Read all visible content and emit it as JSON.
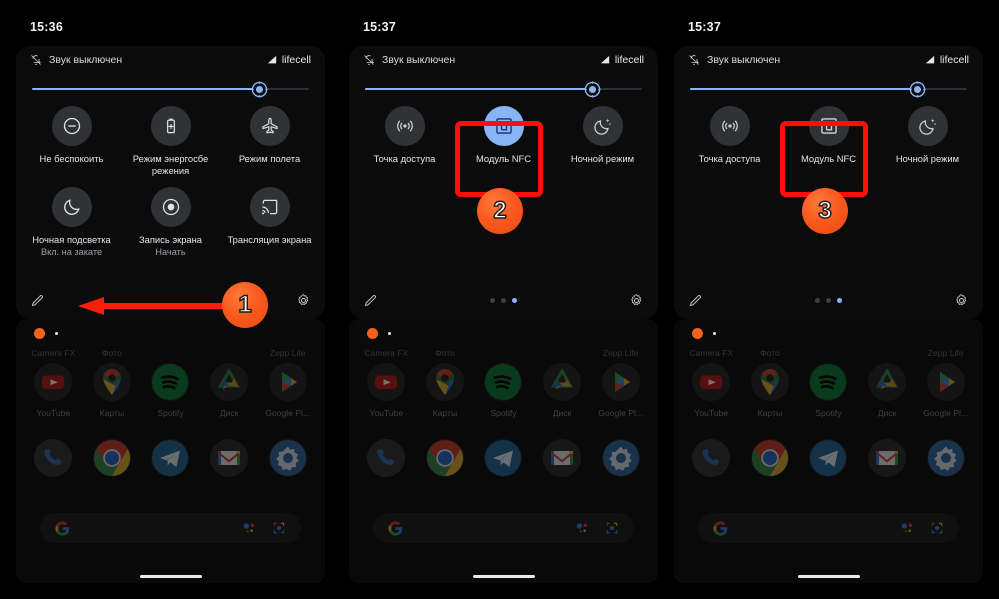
{
  "panels": [
    {
      "id": "panel-1",
      "clock": "15:36",
      "mute_label": "Звук выключен",
      "carrier": "lifecell",
      "brightness_percent": 82,
      "tiles_row1": [
        {
          "label": "Не беспокоить",
          "sub": "",
          "icon": "do-not-disturb-icon",
          "on": false
        },
        {
          "label": "Режим энергосбе режения",
          "sub": "",
          "icon": "battery-saver-icon",
          "on": false
        },
        {
          "label": "Режим полета",
          "sub": "",
          "icon": "airplane-mode-icon",
          "on": false
        }
      ],
      "tiles_row2": [
        {
          "label": "Ночная подсветка",
          "sub": "Вкл. на закате",
          "icon": "night-light-icon",
          "on": false
        },
        {
          "label": "Запись экрана",
          "sub": "Начать",
          "icon": "screen-record-icon",
          "on": false
        },
        {
          "label": "Трансляция экрана",
          "sub": "",
          "icon": "cast-icon",
          "on": false
        }
      ],
      "page_dots": 0,
      "show_dots": false
    },
    {
      "id": "panel-2",
      "clock": "15:37",
      "mute_label": "Звук выключен",
      "carrier": "lifecell",
      "brightness_percent": 82,
      "tiles_row1": [
        {
          "label": "Точка доступа",
          "sub": "",
          "icon": "hotspot-icon",
          "on": false
        },
        {
          "label": "Модуль NFC",
          "sub": "",
          "icon": "nfc-icon",
          "on": true
        },
        {
          "label": "Ночной режим",
          "sub": "",
          "icon": "night-mode-icon",
          "on": false
        }
      ],
      "tiles_row2": [],
      "page_dots": 3,
      "active_dot": 2,
      "show_dots": true
    },
    {
      "id": "panel-3",
      "clock": "15:37",
      "mute_label": "Звук выключен",
      "carrier": "lifecell",
      "brightness_percent": 82,
      "tiles_row1": [
        {
          "label": "Точка доступа",
          "sub": "",
          "icon": "hotspot-icon",
          "on": false
        },
        {
          "label": "Модуль NFC",
          "sub": "",
          "icon": "nfc-icon",
          "on": false
        },
        {
          "label": "Ночной режим",
          "sub": "",
          "icon": "night-mode-icon",
          "on": false
        }
      ],
      "tiles_row2": [],
      "page_dots": 3,
      "active_dot": 2,
      "show_dots": true
    }
  ],
  "home": {
    "cut_row_labels": [
      "Camera FX",
      "Фото",
      "",
      "",
      "Zepp Life"
    ],
    "apps_row1": [
      {
        "label": "YouTube",
        "icon": "youtube-icon"
      },
      {
        "label": "Карты",
        "icon": "google-maps-icon"
      },
      {
        "label": "Spotify",
        "icon": "spotify-icon"
      },
      {
        "label": "Диск",
        "icon": "google-drive-icon"
      },
      {
        "label": "Google Pl...",
        "icon": "google-play-icon"
      }
    ],
    "apps_row2": [
      {
        "label": "",
        "icon": "phone-icon"
      },
      {
        "label": "",
        "icon": "chrome-icon"
      },
      {
        "label": "",
        "icon": "telegram-icon"
      },
      {
        "label": "",
        "icon": "gmail-icon"
      },
      {
        "label": "",
        "icon": "settings-icon"
      }
    ],
    "search_icons": [
      "google-g-icon",
      "assistant-icon",
      "lens-icon"
    ]
  },
  "annotations": {
    "step1": {
      "number": "1",
      "target": "quick-settings-shade-pulldown"
    },
    "step2": {
      "number": "2",
      "target": "nfc-tile-enabled"
    },
    "step3": {
      "number": "3",
      "target": "nfc-tile-disabled"
    }
  },
  "colors": {
    "accent_blue": "#8ab4f8",
    "highlight_red": "#ff0d0d",
    "badge_orange": "#fa5a1e",
    "tile_off": "#313235",
    "background": "#000000"
  },
  "footer_icons": {
    "edit": "pencil-icon",
    "settings": "gear-icon"
  }
}
